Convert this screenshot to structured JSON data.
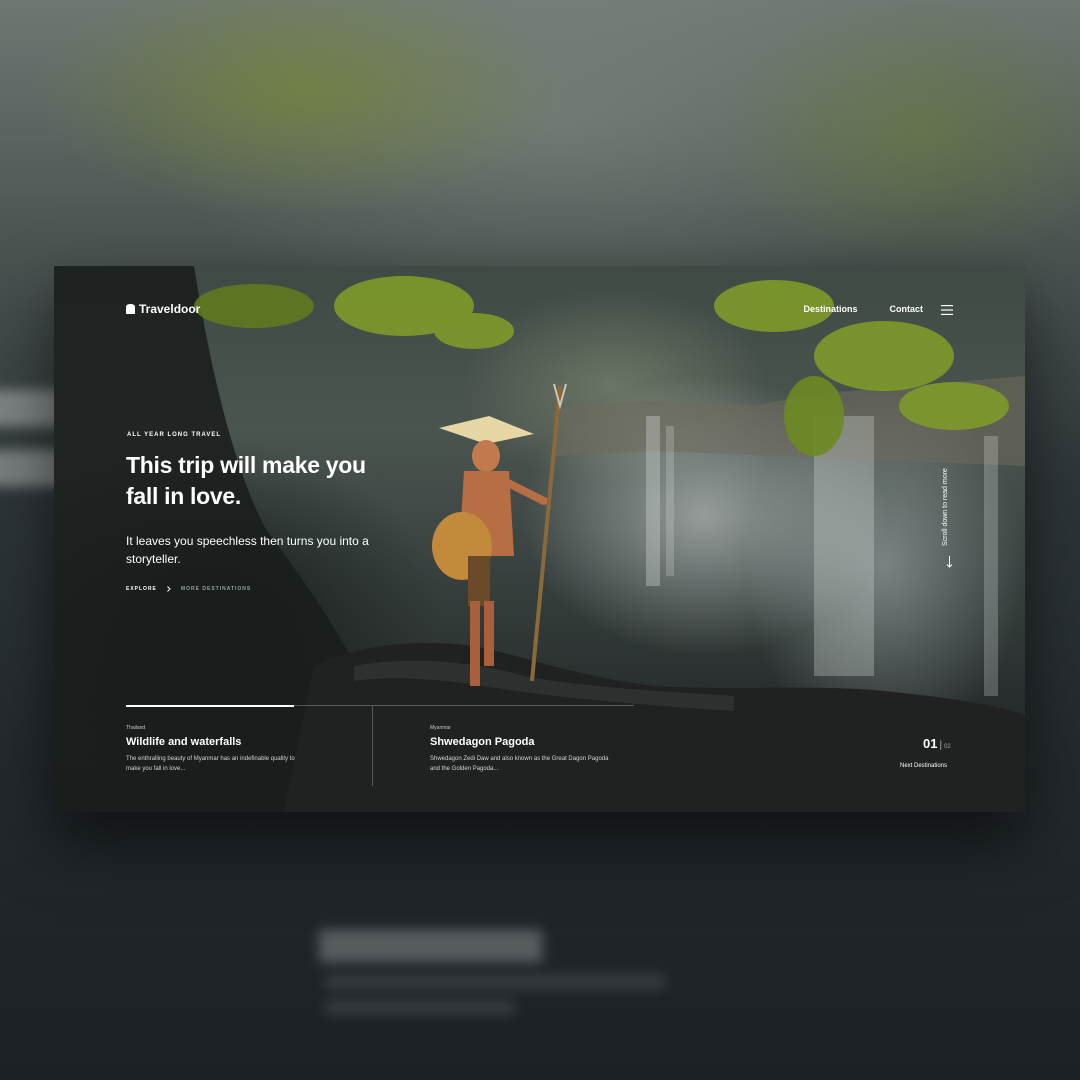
{
  "brand": {
    "name": "Traveldoor"
  },
  "nav": {
    "destinations": "Destinations",
    "contact": "Contact"
  },
  "hero": {
    "eyebrow": "ALL YEAR LONG TRAVEL",
    "headline": "This trip will make you fall in love.",
    "lead": "It leaves you speechless then turns you into a storyteller.",
    "explore": "EXPLORE",
    "more": "MORE DESTINATIONS"
  },
  "scroll": {
    "label": "Scroll down to read more"
  },
  "destinations": [
    {
      "country": "Thailand",
      "name": "Wildlife and waterfalls",
      "desc": "The enthralling beauty of Myanmar has an indefinable quality to make you fall in love..."
    },
    {
      "country": "Myanmar",
      "name": "Shwedagon Pagoda",
      "desc": "Shwedagon Zedi Daw and also known as the Great Dagon Pagoda and the Golden Pagoda..."
    }
  ],
  "pager": {
    "current": "01",
    "total": "02",
    "next": "Next Destinations",
    "progress": 0.33
  },
  "colors": {
    "background": "#1f2428",
    "text": "#ffffff",
    "muted": "#9aa1a0"
  },
  "icons": {
    "logo": "door-icon",
    "menu": "hamburger-menu-icon",
    "explore": "chevron-right-icon",
    "scroll": "arrow-down-icon"
  }
}
